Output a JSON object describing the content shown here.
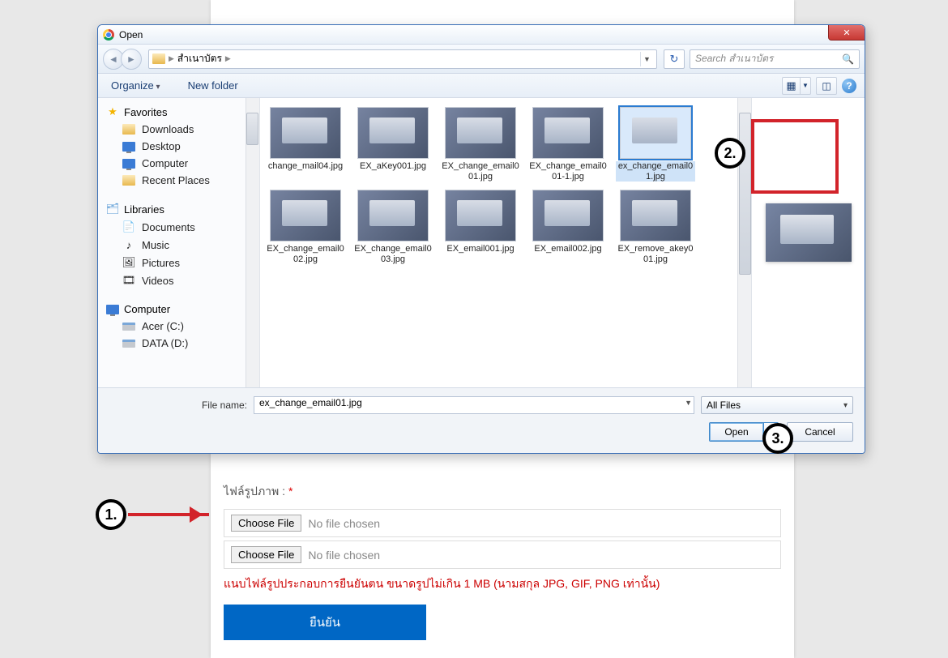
{
  "dialog": {
    "title": "Open",
    "breadcrumb": {
      "folder": "สำเนาบัตร"
    },
    "search_placeholder": "Search สำเนาบัตร",
    "toolbar": {
      "organize": "Organize",
      "new_folder": "New folder"
    },
    "sidebar": {
      "favorites": "Favorites",
      "downloads": "Downloads",
      "desktop": "Desktop",
      "computer_link": "Computer",
      "recent": "Recent Places",
      "libraries": "Libraries",
      "documents": "Documents",
      "music": "Music",
      "pictures": "Pictures",
      "videos": "Videos",
      "computer": "Computer",
      "drive_c": "Acer (C:)",
      "drive_d": "DATA (D:)"
    },
    "files": [
      {
        "name": "change_mail04.jpg"
      },
      {
        "name": "EX_aKey001.jpg"
      },
      {
        "name": "EX_change_email001.jpg"
      },
      {
        "name": "EX_change_email001-1.jpg"
      },
      {
        "name": "ex_change_email01.jpg",
        "selected": true
      },
      {
        "name": "EX_change_email002.jpg"
      },
      {
        "name": "EX_change_email003.jpg"
      },
      {
        "name": "EX_email001.jpg"
      },
      {
        "name": "EX_email002.jpg"
      },
      {
        "name": "EX_remove_akey001.jpg"
      }
    ],
    "filename_label": "File name:",
    "filename_value": "ex_change_email01.jpg",
    "filter": "All Files",
    "open_btn": "Open",
    "cancel_btn": "Cancel"
  },
  "form": {
    "label": "ไฟล์รูปภาพ :",
    "choose": "Choose File",
    "no_file": "No file chosen",
    "warning": "แนบไฟล์รูปประกอบการยืนยันตน ขนาดรูปไม่เกิน 1 MB (นามสกุล JPG, GIF, PNG เท่านั้น)",
    "submit": "ยืนยัน"
  },
  "annot": {
    "n1": "1.",
    "n2": "2.",
    "n3": "3."
  }
}
